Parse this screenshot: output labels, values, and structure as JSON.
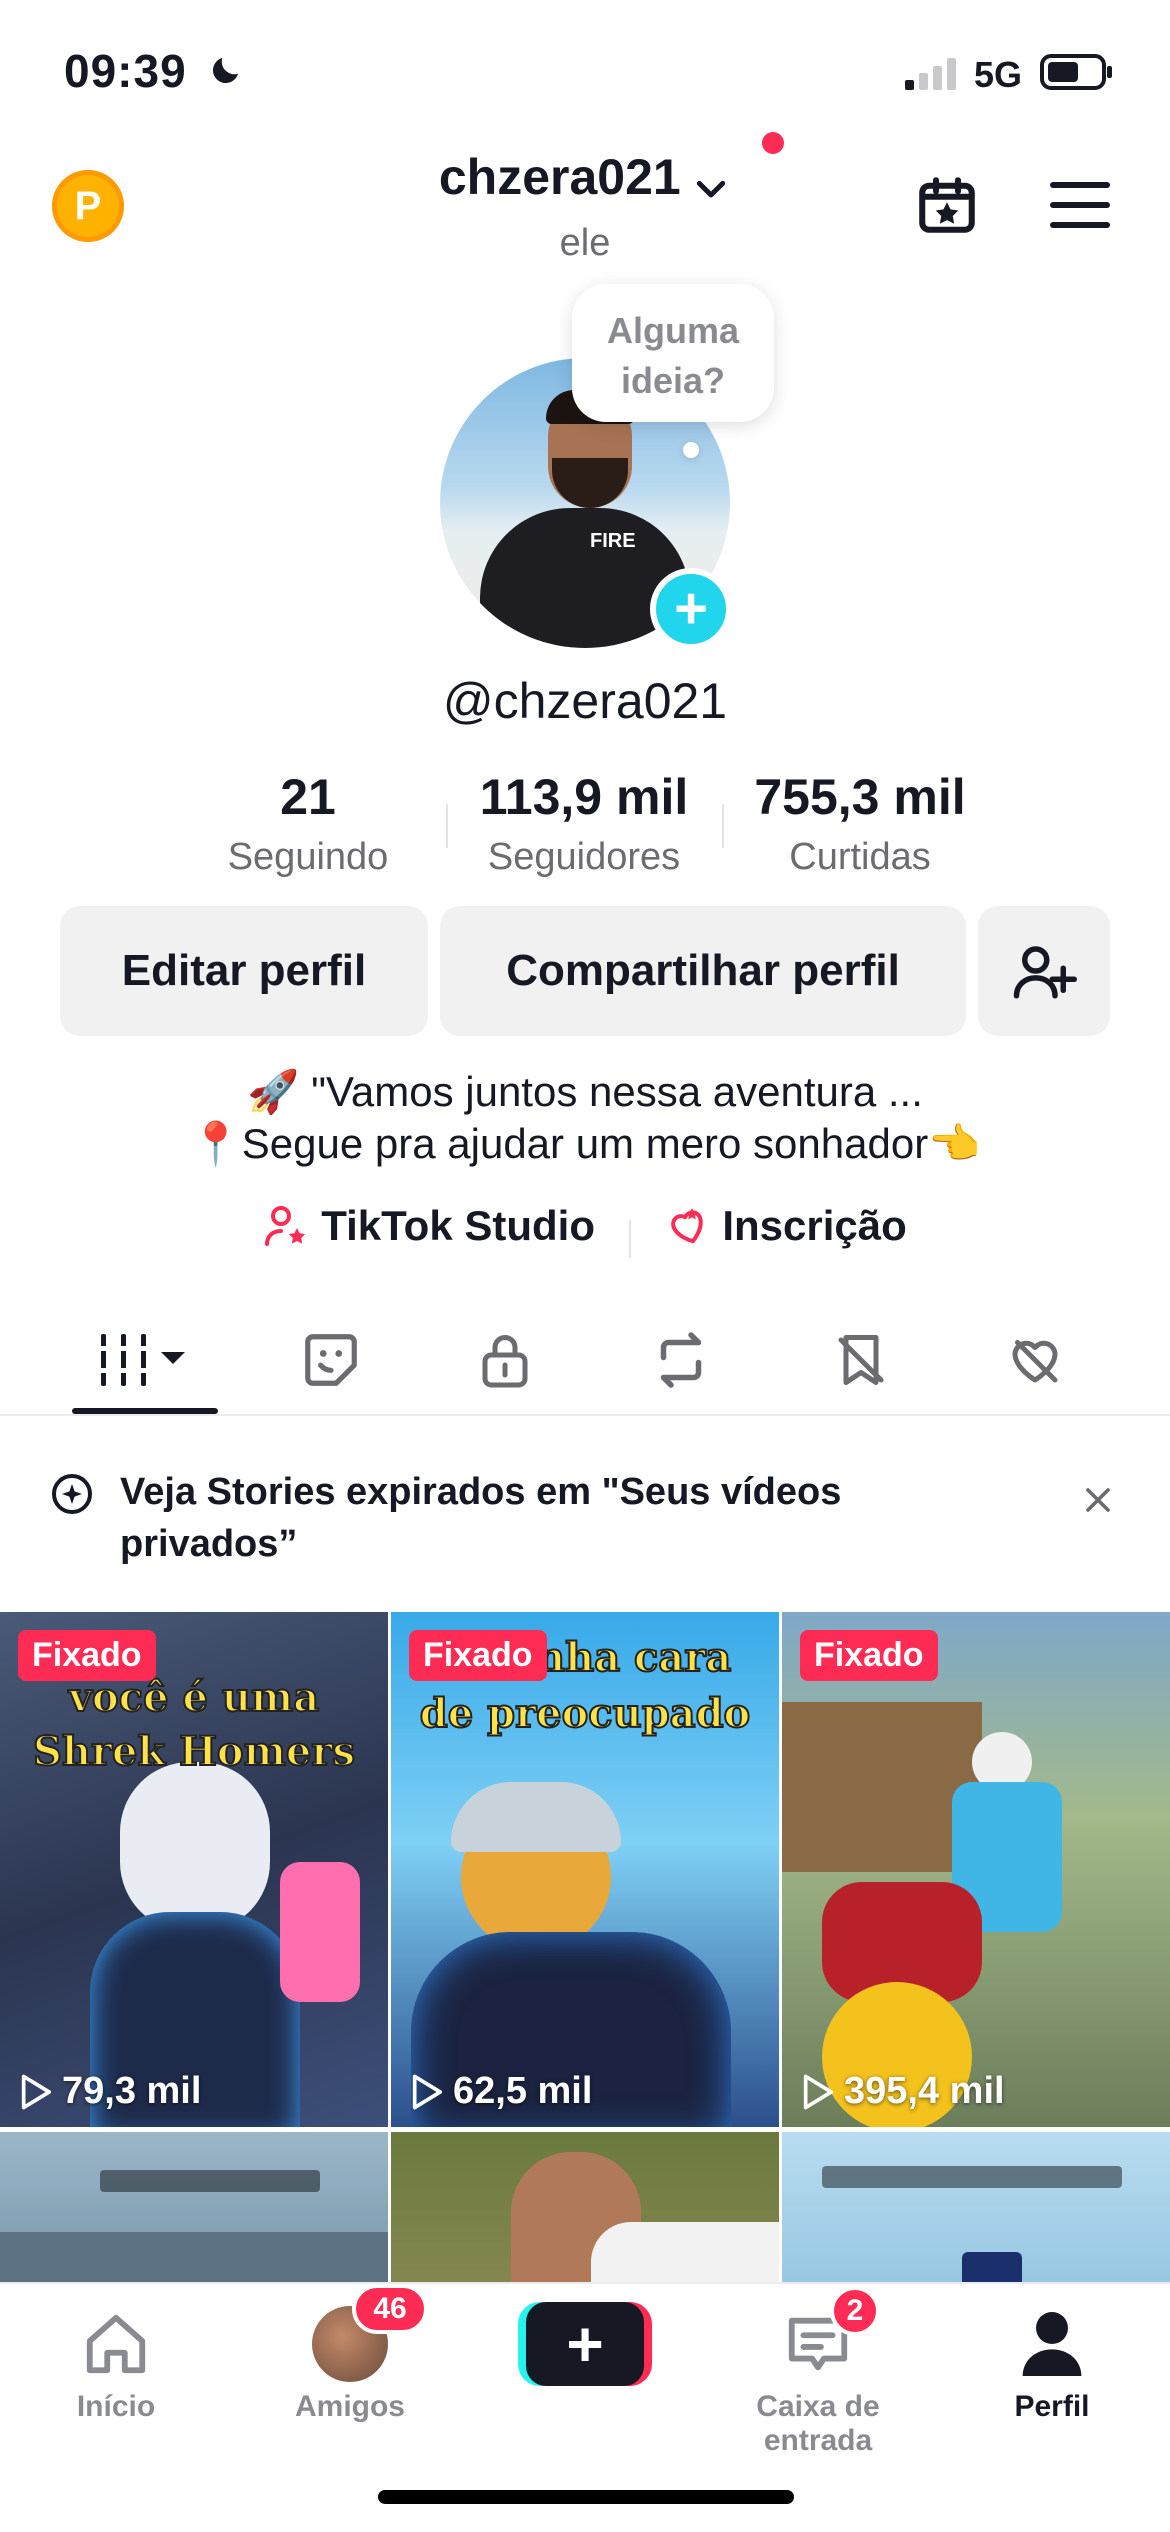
{
  "status_bar": {
    "time": "09:39",
    "network": "5G"
  },
  "header": {
    "username": "chzera021",
    "pronoun": "ele"
  },
  "bubble": {
    "line1": "Alguma",
    "line2": "ideia?"
  },
  "profile": {
    "handle": "@chzera021"
  },
  "stats": [
    {
      "value": "21",
      "label": "Seguindo"
    },
    {
      "value": "113,9 mil",
      "label": "Seguidores"
    },
    {
      "value": "755,3 mil",
      "label": "Curtidas"
    }
  ],
  "buttons": {
    "edit": "Editar perfil",
    "share": "Compartilhar perfil"
  },
  "bio": {
    "line1": "🚀 \"Vamos juntos nessa aventura ...",
    "line2": "📍Segue pra ajudar um mero sonhador👈"
  },
  "links": {
    "studio": "TikTok Studio",
    "subscription": "Inscrição"
  },
  "notice": {
    "text": "Veja Stories expirados em \"Seus vídeos privados”"
  },
  "videos": [
    {
      "pinned": "Fixado",
      "views": "79,3 mil",
      "caption1": "você é uma",
      "caption2": "Shrek Homers"
    },
    {
      "pinned": "Fixado",
      "views": "62,5 mil",
      "caption1": "a minha cara",
      "caption2": "de preocupado"
    },
    {
      "pinned": "Fixado",
      "views": "395,4 mil"
    }
  ],
  "nav": {
    "home": "Início",
    "friends": "Amigos",
    "friends_badge": "46",
    "inbox": "Caixa de entrada",
    "inbox_badge": "2",
    "profile": "Perfil"
  },
  "colors": {
    "accent": "#fe2c55",
    "cyan": "#20d5ec",
    "text": "#161823",
    "muted": "#8a8b91"
  }
}
